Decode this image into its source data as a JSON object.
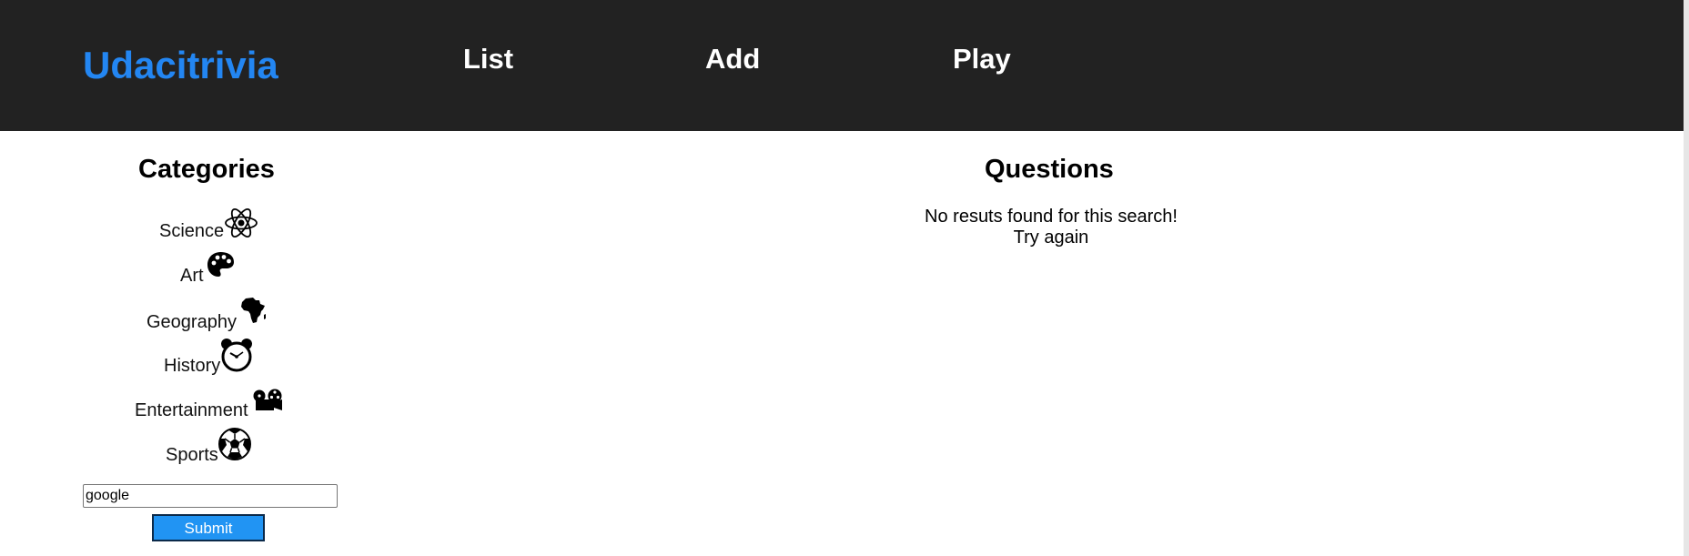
{
  "header": {
    "brand": "Udacitrivia",
    "nav": [
      "List",
      "Add",
      "Play"
    ]
  },
  "sidebar": {
    "title": "Categories",
    "categories": [
      {
        "label": "Science",
        "icon": "science-atom-icon"
      },
      {
        "label": "Art",
        "icon": "art-palette-icon"
      },
      {
        "label": "Geography",
        "icon": "geography-africa-icon"
      },
      {
        "label": "History",
        "icon": "history-clock-icon"
      },
      {
        "label": "Entertainment",
        "icon": "entertainment-projector-icon"
      },
      {
        "label": "Sports",
        "icon": "sports-ball-icon"
      }
    ],
    "search": {
      "value": "google",
      "submit_label": "Submit"
    }
  },
  "questions": {
    "title": "Questions",
    "no_results_line1": "No resuts found for this search!",
    "no_results_line2": "Try again"
  },
  "colors": {
    "header_bg": "#222222",
    "brand": "#2386f2",
    "submit_bg": "#2194f3"
  }
}
